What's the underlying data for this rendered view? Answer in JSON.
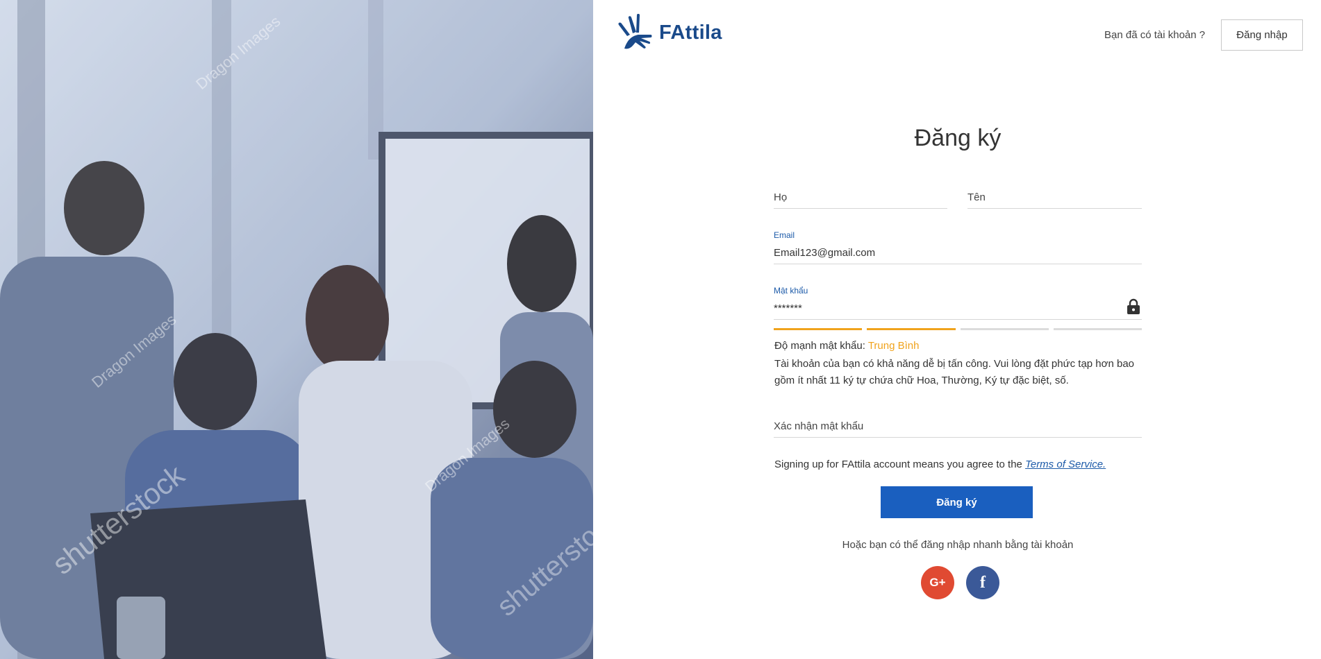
{
  "brand": {
    "name": "FAttila",
    "color": "#1a4a8a"
  },
  "header": {
    "question": "Bạn đã có tài khoản ?",
    "login_label": "Đăng nhập"
  },
  "form": {
    "title": "Đăng ký",
    "last_name_placeholder": "Họ",
    "first_name_placeholder": "Tên",
    "email_label": "Email",
    "email_value": "Email123@gmail.com",
    "password_label": "Mật khẩu",
    "password_value": "*******",
    "password_strength": {
      "label": "Độ mạnh mật khẩu:",
      "level": "Trung Bình",
      "filled_bars": 2,
      "total_bars": 4,
      "color": "#f0a31c",
      "description": "Tài khoản của bạn có khả năng dễ bị tấn công. Vui lòng đặt phức tạp hơn bao gồm ít nhất 11 ký tự chứa chữ Hoa, Thường, Ký tự đặc biệt, số."
    },
    "confirm_password_placeholder": "Xác nhận mật khẩu",
    "terms_text": "Signing up for FAttila account means you agree to the",
    "terms_link": "Terms of Service.",
    "submit_label": "Đăng ký",
    "submit_color": "#1a5fbf"
  },
  "social": {
    "prompt": "Hoặc bạn có thể đăng nhập nhanh bằng tài khoản",
    "google_glyph": "G+",
    "google_icon": "google-plus-icon",
    "google_color": "#e04a32",
    "facebook_glyph": "f",
    "facebook_icon": "facebook-icon",
    "facebook_color": "#3b5998"
  },
  "photo": {
    "watermark_1": "shutterstock",
    "watermark_2": "Dragon Images"
  }
}
